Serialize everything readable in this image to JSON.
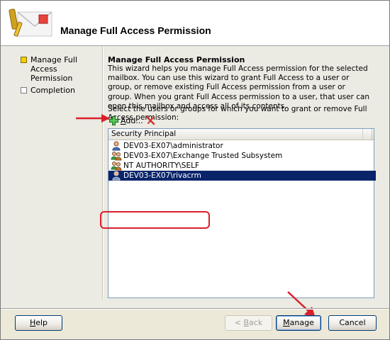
{
  "header": {
    "title": "Manage Full Access Permission"
  },
  "steps": [
    {
      "label_line1": "Manage Full Access",
      "label_line2": "Permission",
      "active": true
    },
    {
      "label_line1": "Completion",
      "label_line2": "",
      "active": false
    }
  ],
  "content": {
    "title": "Manage Full Access Permission",
    "description": "This wizard helps you manage Full Access permission for the selected mailbox. You can use this wizard to grant Full Access to a user or group, or remove existing Full Access permission from a user or group. When you grant Full Access permission to a user, that user can open this mailbox and access all of its contents.",
    "instruction": "Select the users or groups for which you want to grant or remove Full Access permission:"
  },
  "toolbar": {
    "add_label_underlined": "A",
    "add_label_rest": "dd..."
  },
  "list": {
    "column_header": "Security Principal",
    "rows": [
      {
        "text": "DEV03-EX07\\administrator",
        "icon": "user-icon",
        "selected": false
      },
      {
        "text": "DEV03-EX07\\Exchange Trusted Subsystem",
        "icon": "group-icon",
        "selected": false
      },
      {
        "text": "NT AUTHORITY\\SELF",
        "icon": "group-icon",
        "selected": false
      },
      {
        "text": "DEV03-EX07\\rivacrm",
        "icon": "user-icon",
        "selected": true
      }
    ]
  },
  "buttons": {
    "help": {
      "u": "H",
      "rest": "elp"
    },
    "back": {
      "lead": "< ",
      "u": "B",
      "rest": "ack"
    },
    "manage": {
      "u": "M",
      "rest": "anage"
    },
    "cancel": "Cancel"
  },
  "colors": {
    "selection": "#0a246a",
    "annotation_red": "#d9202a"
  }
}
